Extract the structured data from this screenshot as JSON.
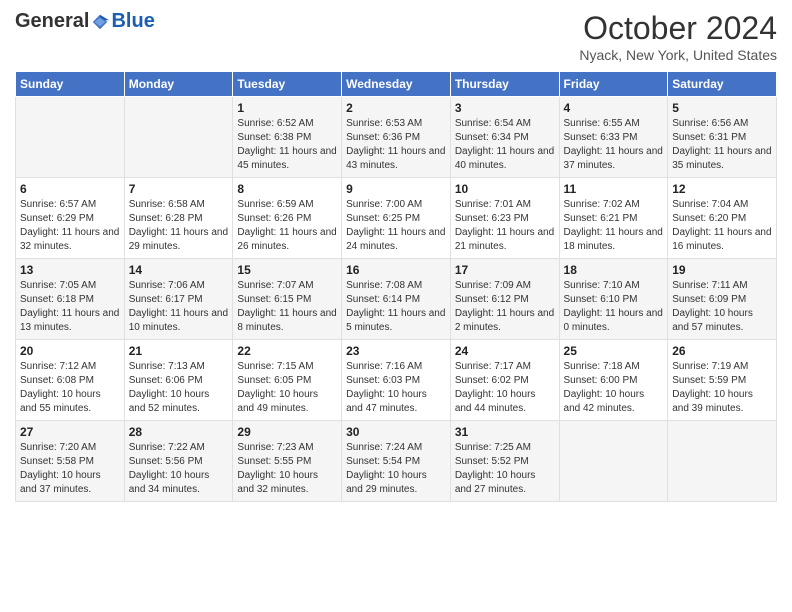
{
  "header": {
    "logo_general": "General",
    "logo_blue": "Blue",
    "month_title": "October 2024",
    "location": "Nyack, New York, United States"
  },
  "days_of_week": [
    "Sunday",
    "Monday",
    "Tuesday",
    "Wednesday",
    "Thursday",
    "Friday",
    "Saturday"
  ],
  "weeks": [
    [
      {
        "day": "",
        "content": ""
      },
      {
        "day": "",
        "content": ""
      },
      {
        "day": "1",
        "content": "Sunrise: 6:52 AM\nSunset: 6:38 PM\nDaylight: 11 hours and 45 minutes."
      },
      {
        "day": "2",
        "content": "Sunrise: 6:53 AM\nSunset: 6:36 PM\nDaylight: 11 hours and 43 minutes."
      },
      {
        "day": "3",
        "content": "Sunrise: 6:54 AM\nSunset: 6:34 PM\nDaylight: 11 hours and 40 minutes."
      },
      {
        "day": "4",
        "content": "Sunrise: 6:55 AM\nSunset: 6:33 PM\nDaylight: 11 hours and 37 minutes."
      },
      {
        "day": "5",
        "content": "Sunrise: 6:56 AM\nSunset: 6:31 PM\nDaylight: 11 hours and 35 minutes."
      }
    ],
    [
      {
        "day": "6",
        "content": "Sunrise: 6:57 AM\nSunset: 6:29 PM\nDaylight: 11 hours and 32 minutes."
      },
      {
        "day": "7",
        "content": "Sunrise: 6:58 AM\nSunset: 6:28 PM\nDaylight: 11 hours and 29 minutes."
      },
      {
        "day": "8",
        "content": "Sunrise: 6:59 AM\nSunset: 6:26 PM\nDaylight: 11 hours and 26 minutes."
      },
      {
        "day": "9",
        "content": "Sunrise: 7:00 AM\nSunset: 6:25 PM\nDaylight: 11 hours and 24 minutes."
      },
      {
        "day": "10",
        "content": "Sunrise: 7:01 AM\nSunset: 6:23 PM\nDaylight: 11 hours and 21 minutes."
      },
      {
        "day": "11",
        "content": "Sunrise: 7:02 AM\nSunset: 6:21 PM\nDaylight: 11 hours and 18 minutes."
      },
      {
        "day": "12",
        "content": "Sunrise: 7:04 AM\nSunset: 6:20 PM\nDaylight: 11 hours and 16 minutes."
      }
    ],
    [
      {
        "day": "13",
        "content": "Sunrise: 7:05 AM\nSunset: 6:18 PM\nDaylight: 11 hours and 13 minutes."
      },
      {
        "day": "14",
        "content": "Sunrise: 7:06 AM\nSunset: 6:17 PM\nDaylight: 11 hours and 10 minutes."
      },
      {
        "day": "15",
        "content": "Sunrise: 7:07 AM\nSunset: 6:15 PM\nDaylight: 11 hours and 8 minutes."
      },
      {
        "day": "16",
        "content": "Sunrise: 7:08 AM\nSunset: 6:14 PM\nDaylight: 11 hours and 5 minutes."
      },
      {
        "day": "17",
        "content": "Sunrise: 7:09 AM\nSunset: 6:12 PM\nDaylight: 11 hours and 2 minutes."
      },
      {
        "day": "18",
        "content": "Sunrise: 7:10 AM\nSunset: 6:10 PM\nDaylight: 11 hours and 0 minutes."
      },
      {
        "day": "19",
        "content": "Sunrise: 7:11 AM\nSunset: 6:09 PM\nDaylight: 10 hours and 57 minutes."
      }
    ],
    [
      {
        "day": "20",
        "content": "Sunrise: 7:12 AM\nSunset: 6:08 PM\nDaylight: 10 hours and 55 minutes."
      },
      {
        "day": "21",
        "content": "Sunrise: 7:13 AM\nSunset: 6:06 PM\nDaylight: 10 hours and 52 minutes."
      },
      {
        "day": "22",
        "content": "Sunrise: 7:15 AM\nSunset: 6:05 PM\nDaylight: 10 hours and 49 minutes."
      },
      {
        "day": "23",
        "content": "Sunrise: 7:16 AM\nSunset: 6:03 PM\nDaylight: 10 hours and 47 minutes."
      },
      {
        "day": "24",
        "content": "Sunrise: 7:17 AM\nSunset: 6:02 PM\nDaylight: 10 hours and 44 minutes."
      },
      {
        "day": "25",
        "content": "Sunrise: 7:18 AM\nSunset: 6:00 PM\nDaylight: 10 hours and 42 minutes."
      },
      {
        "day": "26",
        "content": "Sunrise: 7:19 AM\nSunset: 5:59 PM\nDaylight: 10 hours and 39 minutes."
      }
    ],
    [
      {
        "day": "27",
        "content": "Sunrise: 7:20 AM\nSunset: 5:58 PM\nDaylight: 10 hours and 37 minutes."
      },
      {
        "day": "28",
        "content": "Sunrise: 7:22 AM\nSunset: 5:56 PM\nDaylight: 10 hours and 34 minutes."
      },
      {
        "day": "29",
        "content": "Sunrise: 7:23 AM\nSunset: 5:55 PM\nDaylight: 10 hours and 32 minutes."
      },
      {
        "day": "30",
        "content": "Sunrise: 7:24 AM\nSunset: 5:54 PM\nDaylight: 10 hours and 29 minutes."
      },
      {
        "day": "31",
        "content": "Sunrise: 7:25 AM\nSunset: 5:52 PM\nDaylight: 10 hours and 27 minutes."
      },
      {
        "day": "",
        "content": ""
      },
      {
        "day": "",
        "content": ""
      }
    ]
  ]
}
